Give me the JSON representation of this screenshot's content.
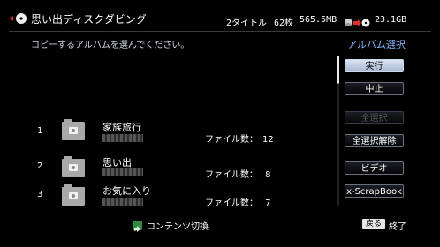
{
  "header": {
    "title": "思い出ディスクダビング",
    "titles": "2タイトル",
    "photos": "62枚",
    "used": "565.5MB",
    "free": "23.1GB"
  },
  "instruction": "コピーするアルバムを選んでください。",
  "mode_label": "アルバム選択",
  "buttons": {
    "run": "実行",
    "cancel": "中止",
    "select_all": "全選択",
    "deselect_all": "全選択解除",
    "video": "ビデオ",
    "xscrapbook": "x-ScrapBook"
  },
  "albums": [
    {
      "num": "1",
      "title": "家族旅行",
      "file_count": "ファイル数：　12"
    },
    {
      "num": "2",
      "title": "思い出",
      "file_count": "ファイル数：　 8"
    },
    {
      "num": "3",
      "title": "お気に入り",
      "file_count": "ファイル数：　 7"
    }
  ],
  "footer": {
    "content_switch": "コンテンツ切換",
    "back_key": "戻る",
    "end": "終了"
  },
  "colors": {
    "accent_blue": "#8fb7ff",
    "green_key": "#2e8b3f",
    "selected_button": "#c3cee2"
  }
}
